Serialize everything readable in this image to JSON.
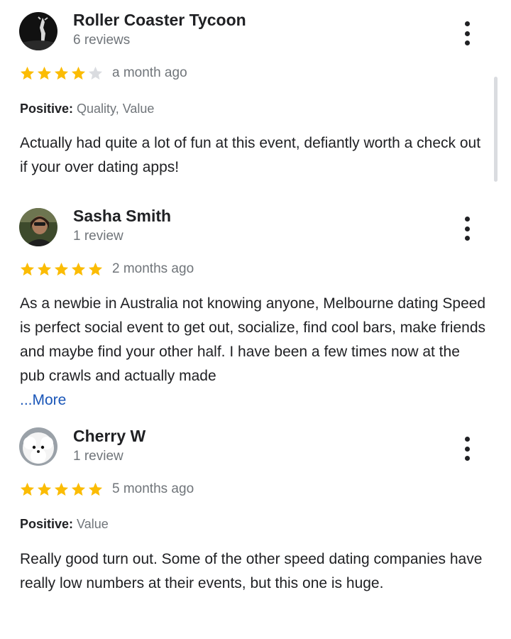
{
  "reviews": [
    {
      "author": "Roller Coaster Tycoon",
      "review_count": "6 reviews",
      "rating": 4,
      "max_rating": 5,
      "date": "a month ago",
      "positive_label": "Positive:",
      "positive_values": " Quality, Value",
      "text": "Actually had quite a lot of fun at this event, defiantly worth a check out if your over dating apps!"
    },
    {
      "author": "Sasha Smith",
      "review_count": "1 review",
      "rating": 5,
      "max_rating": 5,
      "date": "2 months ago",
      "text": "As a newbie in Australia not knowing anyone, Melbourne dating Speed is perfect social event to get out, socialize, find cool bars, make friends and maybe find your other half. I have been a few times now at the pub crawls and actually made",
      "more_label": "...More"
    },
    {
      "author": "Cherry W",
      "review_count": "1 review",
      "rating": 5,
      "max_rating": 5,
      "date": "5 months ago",
      "positive_label": "Positive:",
      "positive_values": " Value",
      "text": "Really good turn out. Some of the other speed dating companies have really low numbers at their events, but this one is huge."
    }
  ],
  "colors": {
    "star_filled": "#fbbc04",
    "star_empty": "#dadce0",
    "link": "#1a56b8",
    "secondary_text": "#70757a"
  },
  "icons": [
    "more-vert-icon",
    "star-icon"
  ]
}
